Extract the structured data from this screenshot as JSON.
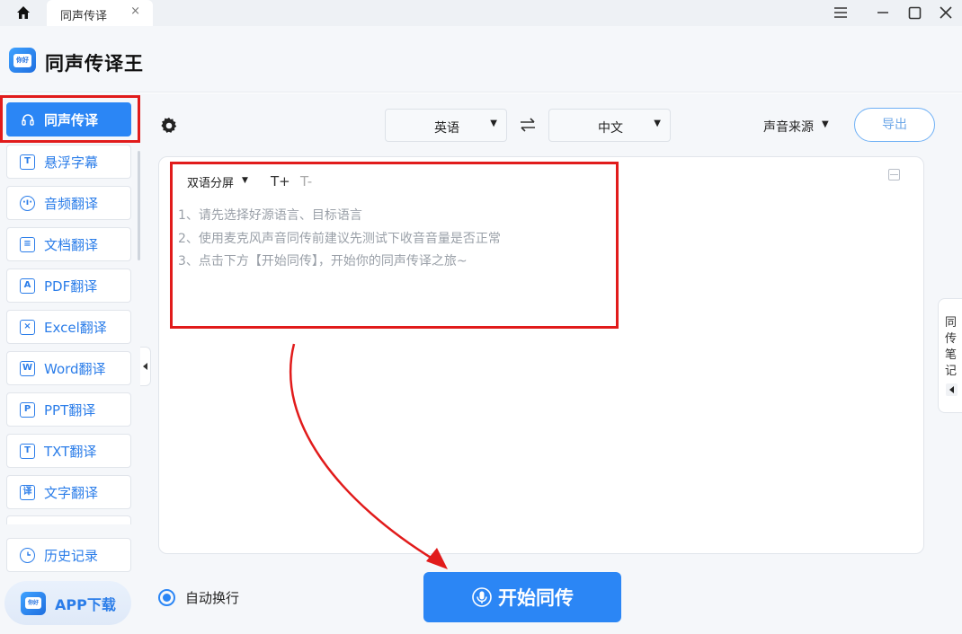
{
  "titlebar": {
    "home_icon": "home-icon",
    "tab_label": "同声传译",
    "tab_close": "×",
    "menu_icon": "menu-icon",
    "minimize_icon": "minimize-icon",
    "maximize_icon": "maximize-icon",
    "close_icon": "close-icon"
  },
  "app": {
    "title": "同声传译王",
    "logo_text": "你好"
  },
  "sidebar": {
    "items": [
      {
        "label": "同声传译",
        "icon": "headphones-icon",
        "active": true
      },
      {
        "label": "悬浮字幕",
        "icon": "text-icon"
      },
      {
        "label": "音频翻译",
        "icon": "audio-icon"
      },
      {
        "label": "文档翻译",
        "icon": "document-icon"
      },
      {
        "label": "PDF翻译",
        "icon": "pdf-icon"
      },
      {
        "label": "Excel翻译",
        "icon": "excel-icon"
      },
      {
        "label": "Word翻译",
        "icon": "word-icon"
      },
      {
        "label": "PPT翻译",
        "icon": "ppt-icon"
      },
      {
        "label": "TXT翻译",
        "icon": "txt-icon"
      },
      {
        "label": "文字翻译",
        "icon": "translate-icon"
      }
    ],
    "history": {
      "label": "历史记录",
      "icon": "clock-icon"
    },
    "app_download": "APP下载"
  },
  "toolbar": {
    "source_language": "英语",
    "target_language": "中文",
    "sound_source": "声音来源",
    "export_label": "导出"
  },
  "editor": {
    "display_mode": "双语分屏",
    "font_increase": "T+",
    "font_decrease": "T-",
    "tips": [
      "1、请先选择好源语言、目标语言",
      "2、使用麦克风声音同传前建议先测试下收音音量是否正常",
      "3、点击下方【开始同传】，开始你的同声传译之旅~"
    ]
  },
  "right_panel": {
    "label": "同传笔记"
  },
  "footer": {
    "auto_wrap_label": "自动换行",
    "auto_wrap_checked": true,
    "start_button": "开始同传"
  },
  "colors": {
    "accent": "#2b86f5",
    "annotation_red": "#e11b1b"
  }
}
